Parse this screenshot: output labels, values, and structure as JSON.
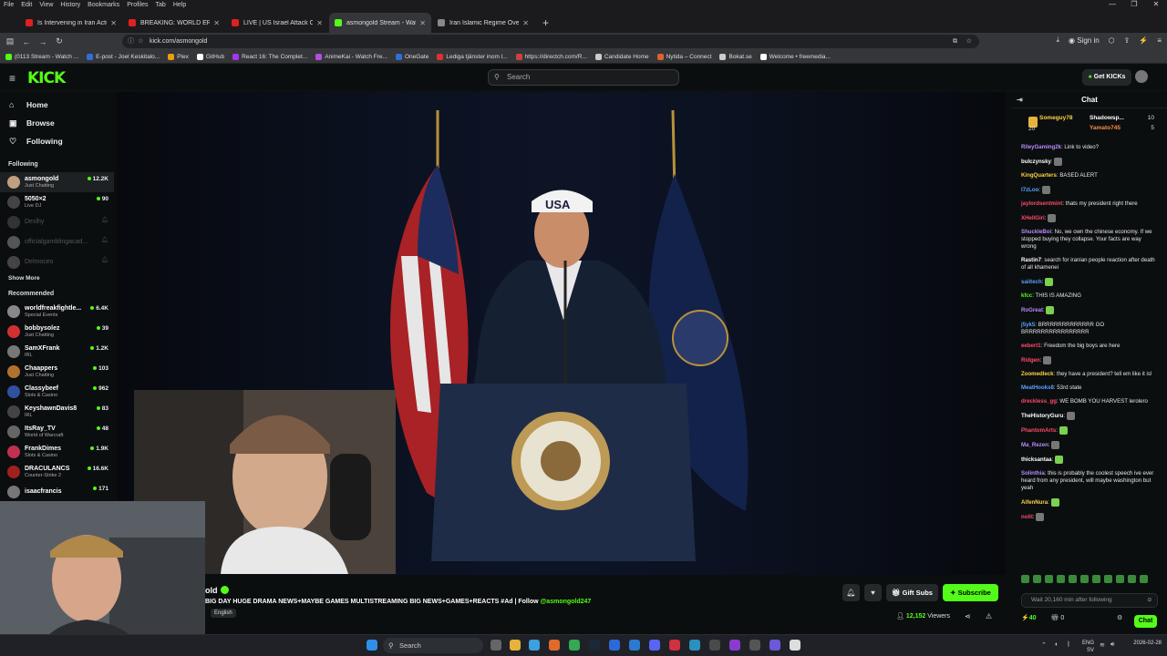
{
  "browser": {
    "menu": [
      "File",
      "Edit",
      "View",
      "History",
      "Bookmarks",
      "Profiles",
      "Tab",
      "Help"
    ],
    "tabs": [
      {
        "title": "Is Intervening in Iran Actually A",
        "color": "#e02020",
        "active": false
      },
      {
        "title": "BREAKING: WORLD ERUPTS AS",
        "color": "#e02020",
        "active": false
      },
      {
        "title": "LIVE | US Israel Attack On I",
        "color": "#e02020",
        "active": false
      },
      {
        "title": "asmongold Stream - Watch",
        "color": "#53fc18",
        "active": true
      },
      {
        "title": "Iran Islamic Regime Overview",
        "color": "#888888",
        "active": false
      }
    ],
    "url": "kick.com/asmongold",
    "signin": "Sign in",
    "bookmarks": [
      {
        "label": "(0113 Stream - Watch ...",
        "color": "#53fc18"
      },
      {
        "label": "E-post - Joel Keskitalo...",
        "color": "#2f6fd8"
      },
      {
        "label": "Plex",
        "color": "#e5a00d"
      },
      {
        "label": "GitHub",
        "color": "#ffffff"
      },
      {
        "label": "React 16: The Complet...",
        "color": "#a435f0"
      },
      {
        "label": "AnimeKai - Watch Fre...",
        "color": "#b44fe0"
      },
      {
        "label": "OneGate",
        "color": "#2f6fd8"
      },
      {
        "label": "Lediga tjänster inom l...",
        "color": "#e03030"
      },
      {
        "label": "https://directch.com/R...",
        "color": "#d04040"
      },
      {
        "label": "Candidate Home",
        "color": "#cccccc"
      },
      {
        "label": "Nytida – Connect",
        "color": "#e06030"
      },
      {
        "label": "Bokat.se",
        "color": "#cccccc"
      },
      {
        "label": "Welcome • freemedia...",
        "color": "#ffffff"
      }
    ]
  },
  "kick": {
    "logo": "KICK",
    "search_placeholder": "Search",
    "get_kicks": "Get KICKs"
  },
  "sidebar": {
    "nav": [
      {
        "label": "Home",
        "icon": "home-icon",
        "glyph": "⌂"
      },
      {
        "label": "Browse",
        "icon": "browse-icon",
        "glyph": "▣"
      },
      {
        "label": "Following",
        "icon": "heart-icon",
        "glyph": "♡"
      }
    ],
    "following_title": "Following",
    "following": [
      {
        "name": "asmongold",
        "sub": "Just Chatting",
        "viewers": "12.2K",
        "color": "#c0a080",
        "online": true,
        "selected": true
      },
      {
        "name": "5050×2",
        "sub": "Live DJ",
        "viewers": "90",
        "color": "#444444",
        "online": true,
        "selected": false
      },
      {
        "name": "Dexlhy",
        "sub": "",
        "viewers": "",
        "color": "#333333",
        "online": false,
        "selected": false
      },
      {
        "name": "officialgamblingacad...",
        "sub": "",
        "viewers": "",
        "color": "#555555",
        "online": false,
        "selected": false
      },
      {
        "name": "Delmoceo",
        "sub": "",
        "viewers": "",
        "color": "#444444",
        "online": false,
        "selected": false
      }
    ],
    "show_more": "Show More",
    "recommended_title": "Recommended",
    "recommended": [
      {
        "name": "worldfreakfightle...",
        "sub": "Special Events",
        "viewers": "6.4K",
        "color": "#888888"
      },
      {
        "name": "bobbysolez",
        "sub": "Just Chatting",
        "viewers": "39",
        "color": "#d03030"
      },
      {
        "name": "SamXFrank",
        "sub": "IRL",
        "viewers": "1.2K",
        "color": "#777777"
      },
      {
        "name": "Chaappers",
        "sub": "Just Chatting",
        "viewers": "103",
        "color": "#b07030"
      },
      {
        "name": "Classybeef",
        "sub": "Slots & Casino",
        "viewers": "962",
        "color": "#3050a0"
      },
      {
        "name": "KeyshawnDavis8",
        "sub": "IRL",
        "viewers": "83",
        "color": "#444444"
      },
      {
        "name": "ItsRay_TV",
        "sub": "World of Warcraft",
        "viewers": "48",
        "color": "#666666"
      },
      {
        "name": "FrankDimes",
        "sub": "Slots & Casino",
        "viewers": "1.9K",
        "color": "#c03050"
      },
      {
        "name": "DRACULANCS",
        "sub": "Counter-Strike 2",
        "viewers": "16.6K",
        "color": "#a02020"
      },
      {
        "name": "isaacfrancis",
        "sub": "",
        "viewers": "171",
        "color": "#777777"
      }
    ]
  },
  "stream": {
    "channel": "old",
    "title": "BIG DAY HUGE DRAMA NEWS+MAYBE GAMES MULTISTREAMING BIG NEWS+GAMES+REACTS #Ad | Follow ",
    "follow_handle": "@asmongold247",
    "tag": "English",
    "gift_subs": "Gift Subs",
    "subscribe": "Subscribe",
    "viewers": "12,152",
    "viewers_label": "Viewers",
    "podium_sign": "USA"
  },
  "chat": {
    "title": "Chat",
    "pinned": [
      {
        "user": "Someguy78",
        "count": "20"
      },
      {
        "user": "Shadowsp...",
        "count": "10"
      },
      {
        "user": "Yamato745",
        "count": "5"
      }
    ],
    "messages": [
      {
        "user": "RileyGaming2k",
        "color": "#b88cff",
        "text": "Link to video?"
      },
      {
        "user": "bulczynsky",
        "color": "#ffffff",
        "text": ""
      },
      {
        "user": "KingQuarters",
        "color": "#ffd24a",
        "text": "BASED ALERT"
      },
      {
        "user": "I7zLoo",
        "color": "#5aa0ff",
        "text": ""
      },
      {
        "user": "jaylordsentmint",
        "color": "#ff4a6a",
        "text": "thats my president right there"
      },
      {
        "user": "XHellGiri",
        "color": "#ff4a6a",
        "text": ""
      },
      {
        "user": "ShuckleBoi",
        "color": "#b88cff",
        "text": "No, we own the chinese economy. If we stopped buying they collapse. Your facts are way wrong"
      },
      {
        "user": "Rastin7",
        "color": "#ffffff",
        "text": "search for iranian people reaction after death of all khamenei"
      },
      {
        "user": "saiitech",
        "color": "#5aa0ff",
        "text": ""
      },
      {
        "user": "kfcc",
        "color": "#53fc18",
        "text": "THIS IS AMAZING"
      },
      {
        "user": "RoGreat",
        "color": "#b88cff",
        "text": ""
      },
      {
        "user": "j5yk5",
        "color": "#5aa0ff",
        "text": "BRRRRRRRRRRRRR GO BRRRRRRRRRRRRRRRR"
      },
      {
        "user": "eebert1",
        "color": "#ff4a6a",
        "text": "Freedom the big boys are here"
      },
      {
        "user": "Ridgen",
        "color": "#ff4a6a",
        "text": ""
      },
      {
        "user": "Zoomedleck",
        "color": "#ffd24a",
        "text": "they have a president? tell em like it is!"
      },
      {
        "user": "MeatHooks8",
        "color": "#5aa0ff",
        "text": "53rd state"
      },
      {
        "user": "dreckless_gg",
        "color": "#ff4a6a",
        "text": "WE BOMB YOU HARVEST lerolero"
      },
      {
        "user": "TheHistoryGuru",
        "color": "#ffffff",
        "text": ""
      },
      {
        "user": "PhantomArts",
        "color": "#ff4a6a",
        "text": ""
      },
      {
        "user": "Ma_Rezen",
        "color": "#b88cff",
        "text": ""
      },
      {
        "user": "thicksantaa",
        "color": "#ffffff",
        "text": ""
      },
      {
        "user": "Solinthia",
        "color": "#b88cff",
        "text": "this is probably the coolest speech ive ever heard from any president, will maybe washington but yeah"
      },
      {
        "user": "AifenNura",
        "color": "#ffd24a",
        "text": ""
      },
      {
        "user": "nolit",
        "color": "#ff4a6a",
        "text": ""
      }
    ],
    "input_placeholder": "Wait 20,160 min after following",
    "kicks": "40",
    "gifts": "0",
    "chat_button": "Chat"
  },
  "taskbar": {
    "search": "Search",
    "lang": "ENG",
    "region": "SV",
    "time": "",
    "date": "2026-02-28"
  }
}
